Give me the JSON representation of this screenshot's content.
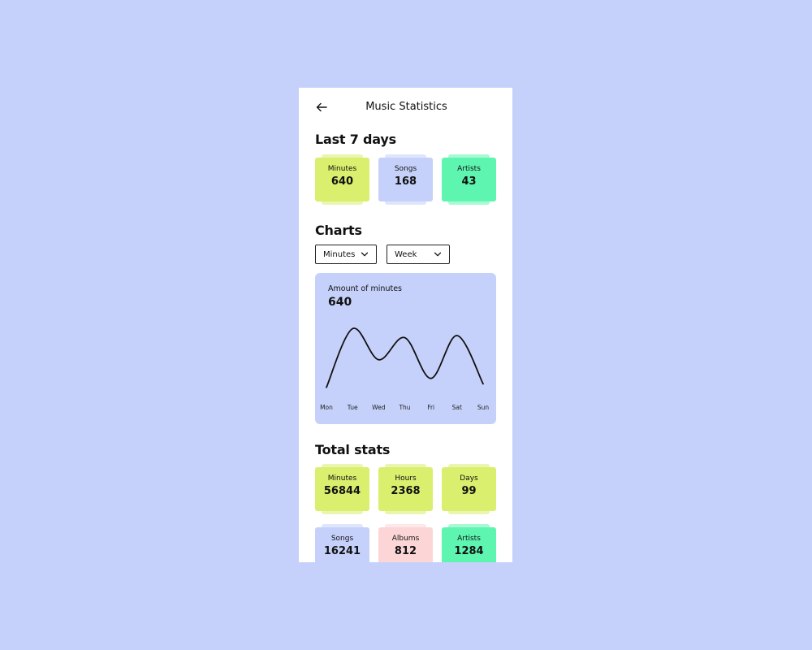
{
  "header": {
    "title": "Music Statistics",
    "back_icon": "arrow-left-icon"
  },
  "last7": {
    "title": "Last 7 days",
    "cards": [
      {
        "label": "Minutes",
        "value": "640",
        "color": "#d9ef6d"
      },
      {
        "label": "Songs",
        "value": "168",
        "color": "#c5d1fa"
      },
      {
        "label": "Artists",
        "value": "43",
        "color": "#5ef5b1"
      }
    ]
  },
  "charts": {
    "title": "Charts",
    "metric_select": {
      "value": "Minutes",
      "icon": "chevron-down-icon"
    },
    "period_select": {
      "value": "Week",
      "icon": "chevron-down-icon"
    },
    "card_label": "Amount of minutes",
    "card_value": "640"
  },
  "chart_data": {
    "type": "line",
    "x": [
      "Mon",
      "Tue",
      "Wed",
      "Thu",
      "Fri",
      "Sat",
      "Sun"
    ],
    "series": [
      {
        "values": [
          5,
          90,
          45,
          77,
          18,
          80,
          10
        ]
      }
    ],
    "ylim": [
      0,
      100
    ],
    "grid": false,
    "color": "#111111"
  },
  "total": {
    "title": "Total stats",
    "cards": [
      {
        "label": "Minutes",
        "value": "56844",
        "color": "#d9ef6d"
      },
      {
        "label": "Hours",
        "value": "2368",
        "color": "#d9ef6d"
      },
      {
        "label": "Days",
        "value": "99",
        "color": "#d9ef6d"
      },
      {
        "label": "Songs",
        "value": "16241",
        "color": "#c5d1fa"
      },
      {
        "label": "Albums",
        "value": "812",
        "color": "#fcd6d7"
      },
      {
        "label": "Artists",
        "value": "1284",
        "color": "#5ef5b1"
      }
    ]
  },
  "colors": {
    "background": "#c5d1fa",
    "panel": "#ffffff",
    "lime": "#d9ef6d",
    "lavender": "#c5d1fa",
    "mint": "#5ef5b1",
    "pink": "#fcd6d7"
  }
}
